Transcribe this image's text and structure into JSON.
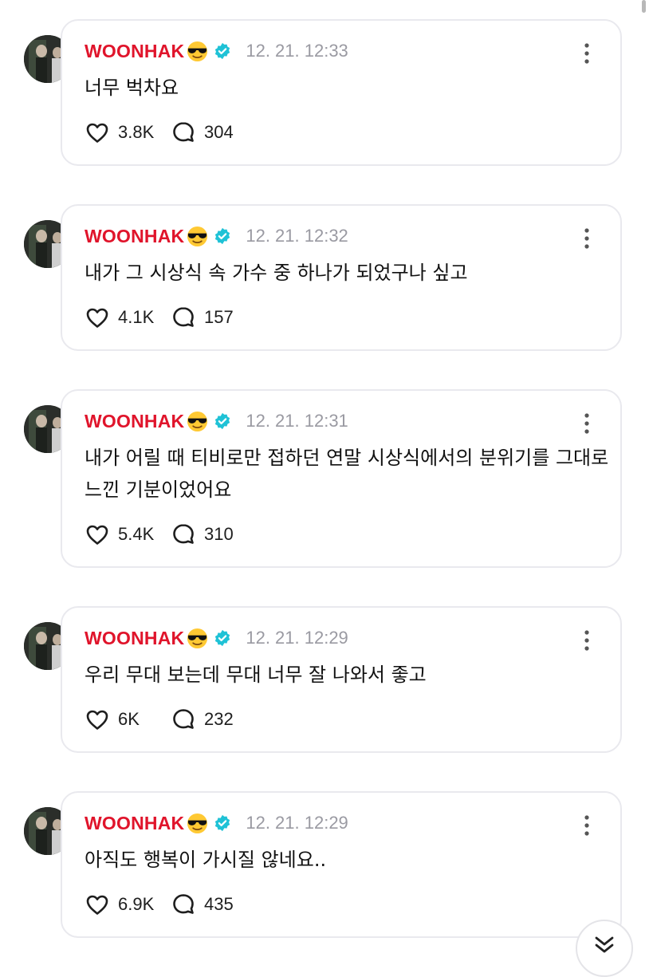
{
  "posts": [
    {
      "author": "WOONHAK",
      "time": "12. 21. 12:33",
      "text": "너무 벅차요",
      "likes": "3.8K",
      "comments": "304"
    },
    {
      "author": "WOONHAK",
      "time": "12. 21. 12:32",
      "text": "내가 그 시상식 속 가수 중 하나가 되었구나 싶고",
      "likes": "4.1K",
      "comments": "157"
    },
    {
      "author": "WOONHAK",
      "time": "12. 21. 12:31",
      "text": "내가 어릴 때 티비로만 접하던 연말 시상식에서의 분위기를 그대로 느낀 기분이었어요",
      "likes": "5.4K",
      "comments": "310"
    },
    {
      "author": "WOONHAK",
      "time": "12. 21. 12:29",
      "text": "우리 무대 보는데 무대 너무 잘 나와서 좋고",
      "likes": "6K",
      "comments": "232"
    },
    {
      "author": "WOONHAK",
      "time": "12. 21. 12:29",
      "text": "아직도 행복이 가시질 않네요..",
      "likes": "6.9K",
      "comments": "435"
    }
  ],
  "icons": {
    "author_emoji": "sunglasses-face-icon",
    "verified": "verified-badge-icon",
    "more": "more-vertical-icon",
    "like": "heart-icon",
    "comment": "comment-bubble-icon",
    "scroll": "chevron-double-down-icon"
  },
  "colors": {
    "name": "#e0142b",
    "verified": "#1fc2d6",
    "muted": "#9a9aa2"
  }
}
